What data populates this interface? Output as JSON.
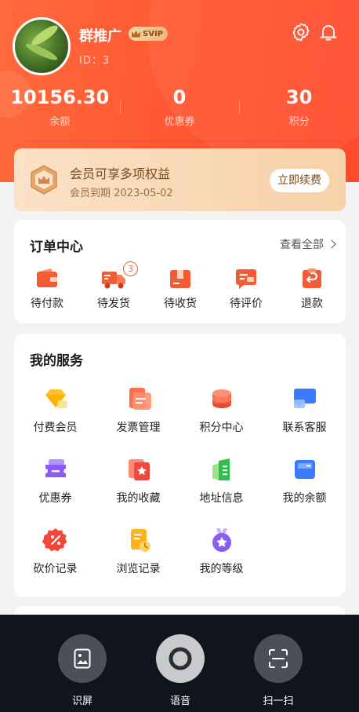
{
  "profile": {
    "name": "群推广",
    "badge": "SVIP",
    "id_text": "ID：3"
  },
  "stats": [
    {
      "value": "10156.30",
      "label": "余额"
    },
    {
      "value": "0",
      "label": "优惠券"
    },
    {
      "value": "30",
      "label": "积分"
    }
  ],
  "membership": {
    "title": "会员可享多项权益",
    "expiry": "会员到期 2023-05-02",
    "renew_label": "立即续费"
  },
  "orders": {
    "title": "订单中心",
    "view_all": "查看全部",
    "items": [
      {
        "label": "待付款",
        "icon": "wallet-icon"
      },
      {
        "label": "待发货",
        "icon": "truck-icon",
        "badge": "3"
      },
      {
        "label": "待收货",
        "icon": "box-icon"
      },
      {
        "label": "待评价",
        "icon": "comment-icon"
      },
      {
        "label": "退款",
        "icon": "refund-icon"
      }
    ]
  },
  "services": {
    "title": "我的服务",
    "items": [
      {
        "label": "付费会员",
        "icon": "diamond-icon"
      },
      {
        "label": "发票管理",
        "icon": "invoice-icon"
      },
      {
        "label": "积分中心",
        "icon": "coins-icon"
      },
      {
        "label": "联系客服",
        "icon": "chat-icon"
      },
      {
        "label": "优惠券",
        "icon": "coupon-icon"
      },
      {
        "label": "我的收藏",
        "icon": "favorite-icon"
      },
      {
        "label": "地址信息",
        "icon": "address-icon"
      },
      {
        "label": "我的余额",
        "icon": "balance-icon"
      },
      {
        "label": "砍价记录",
        "icon": "bargain-icon"
      },
      {
        "label": "浏览记录",
        "icon": "history-icon"
      },
      {
        "label": "我的等级",
        "icon": "level-icon"
      }
    ]
  },
  "bottom_bar": {
    "items": [
      {
        "label": "识屏",
        "icon": "screen-recognize-icon"
      },
      {
        "label": "语音",
        "icon": "voice-icon"
      },
      {
        "label": "扫一扫",
        "icon": "scan-icon"
      }
    ]
  },
  "colors": {
    "accent": "#ff5530",
    "member_gold": "#f7d1a9",
    "bottom_bar": "#0f141d"
  }
}
